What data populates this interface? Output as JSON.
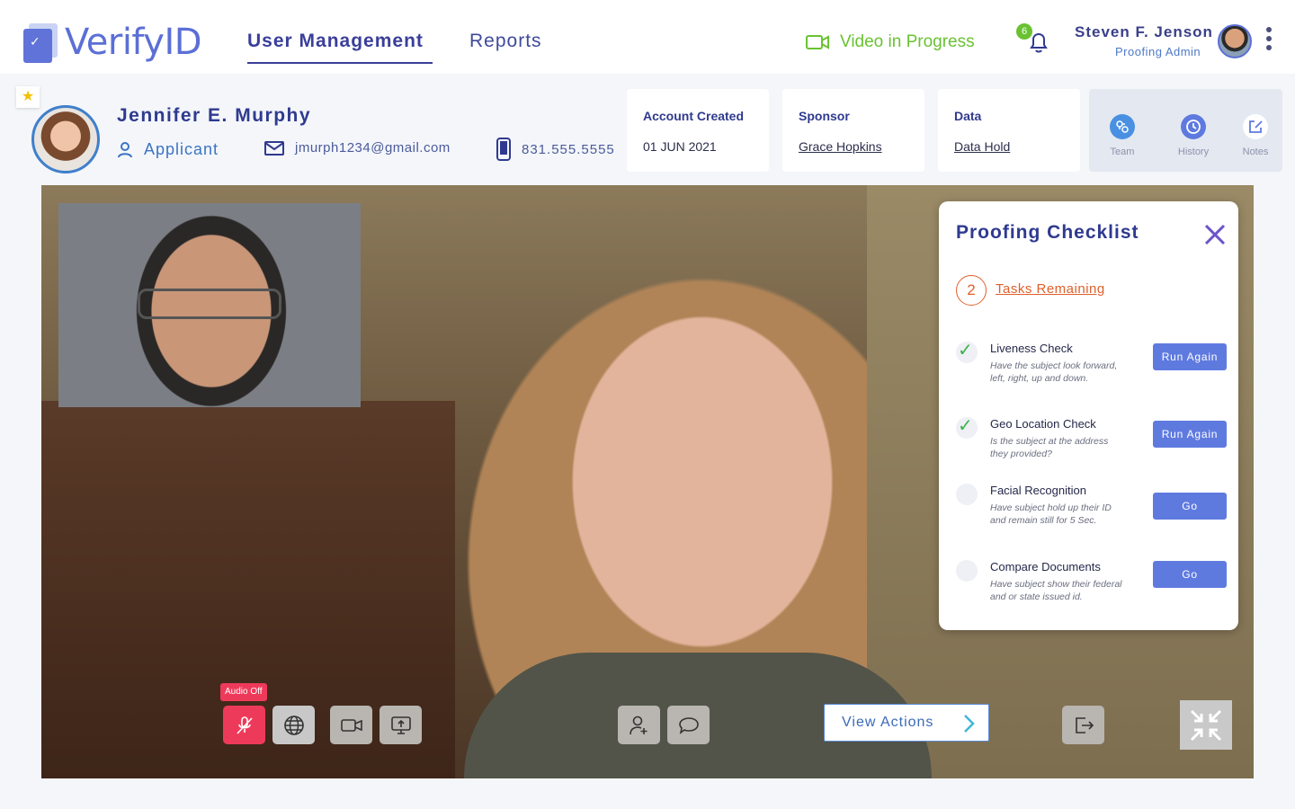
{
  "app": {
    "name": "VerifyID"
  },
  "nav": {
    "tabs": [
      {
        "label": "User Management",
        "active": true
      },
      {
        "label": "Reports",
        "active": false
      }
    ]
  },
  "status": {
    "label": "Video in Progress",
    "color": "#6ac232"
  },
  "notifications": {
    "count": "6"
  },
  "user": {
    "name": "Steven F. Jenson",
    "role": "Proofing Admin"
  },
  "applicant": {
    "name": "Jennifer E. Murphy",
    "role": "Applicant",
    "email": "jmurph1234@gmail.com",
    "phone": "831.555.5555",
    "favorite": true
  },
  "info_cards": [
    {
      "label": "Account Created",
      "value": "01 JUN  2021"
    },
    {
      "label": "Sponsor",
      "value": "Grace Hopkins"
    },
    {
      "label": "Data",
      "value": "Data Hold"
    }
  ],
  "tools": [
    {
      "label": "Team",
      "icon": "team-icon"
    },
    {
      "label": "History",
      "icon": "clock-icon"
    },
    {
      "label": "Notes",
      "icon": "edit-icon"
    }
  ],
  "checklist": {
    "title": "Proofing Checklist",
    "remaining_count": "2",
    "remaining_label": "Tasks Remaining",
    "tasks": [
      {
        "name": "Liveness Check",
        "description": "Have the subject look forward, left, right, up and down.",
        "done": true,
        "action": "Run Again"
      },
      {
        "name": "Geo Location Check",
        "description": "Is the subject at the address they provided?",
        "done": true,
        "action": "Run Again"
      },
      {
        "name": "Facial Recognition",
        "description": "Have subject hold up their ID and remain still for 5 Sec.",
        "done": false,
        "action": "Go"
      },
      {
        "name": "Compare Documents",
        "description": "Have subject show their federal and or state issued id.",
        "done": false,
        "action": "Go"
      }
    ]
  },
  "controls": {
    "audio_tooltip": "Audio Off",
    "view_actions": "View Actions"
  },
  "colors": {
    "brand": "#5b6fd6",
    "navy": "#2f3a8f",
    "accent_orange": "#e0602c",
    "danger": "#ee3a5a",
    "button_blue": "#5f7adf"
  }
}
